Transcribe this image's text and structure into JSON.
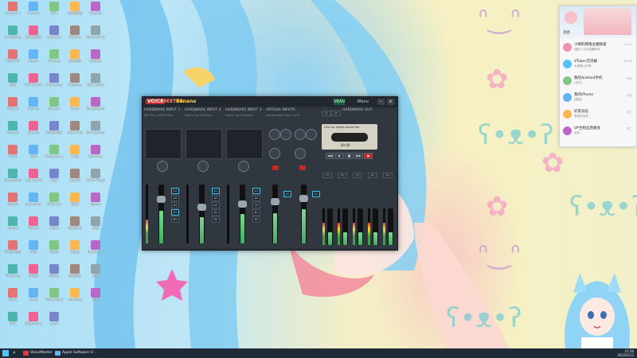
{
  "desktop": {
    "icons": [
      "Scratch 3",
      "Foxmail",
      "RDR",
      "小鸡模拟器",
      "Thunder",
      "MarkDown",
      "雷电模拟器",
      "Audacity",
      "VMware",
      "Microsoft Edge",
      "UPUPOO",
      "Steam",
      "Chrome",
      "百度网盘",
      "腾讯QQ",
      "微信",
      "OBS Studio",
      "Photoshop",
      "Premiere",
      "WPS Office",
      "VSCode",
      "GitHub",
      "Blender",
      "Zoom",
      "VoiceMeeter",
      "Discord",
      "Spotify",
      "网易云音乐",
      "Unity Hub",
      "Epic Games",
      "FFXIV",
      "原神",
      "Notepad++",
      "7-Zip",
      "Bandizip",
      "Everything",
      "Clip Studio",
      "SAI2",
      "Live2D",
      "VTube Studio",
      "Python",
      "Anaconda",
      "PyCharm",
      "IDEA",
      "Typora",
      "Xmind",
      "Todesk",
      "向日葵",
      "KK录像机",
      "剪映",
      "Bilibili直播",
      "抖音",
      "Origin",
      "Uplay",
      "Battle.net",
      "WeGame",
      "此电脑",
      "回收站",
      "控制面板",
      "网络",
      "Word",
      "Excel",
      "PowerPoint",
      "OneNote",
      "迅雷",
      "IDM",
      "qBittorrent",
      "aria2"
    ]
  },
  "voicemeeter": {
    "logo_voice": "VOICE",
    "logo_meeter": "MEETER",
    "logo_banana": "Banana",
    "menu_label": "Menu",
    "vban_label": "VBAN",
    "strips": [
      {
        "name": "HARDWARE INPUT 1",
        "sub": "MIC Ch1 (USB Audio)"
      },
      {
        "name": "HARDWARE INPUT 2",
        "sub": "Select Input Device"
      },
      {
        "name": "HARDWARE INPUT 3",
        "sub": "Select Input Device"
      },
      {
        "name": "VIRTUAL INPUTS",
        "sub": "Voicemeeter VAIO / AUX"
      }
    ],
    "hardware_out_label": "HARDWARE OUT",
    "cassette_label": "Click to Select Audio File",
    "cassette_time": "00:00",
    "bus_buttons": [
      "A1",
      "A2",
      "A3",
      "B1",
      "B2"
    ],
    "out_labels": [
      "A1",
      "A2",
      "A3",
      "B1",
      "B2"
    ],
    "fader_levels": [
      0.55,
      0.45,
      0.5,
      0.52,
      0.58,
      0.35,
      0.35,
      0.35,
      0.35,
      0.35
    ]
  },
  "qq": {
    "tab_label": "消息",
    "items": [
      {
        "name": "小明的网络主播频道",
        "msg": "[图片] 今天直播时间",
        "time": "10:23"
      },
      {
        "name": "VTuber交流群",
        "msg": "大家晚上好呀",
        "time": "09:58"
      },
      {
        "name": "我的Android手机",
        "msg": "[文件]",
        "time": "昨天"
      },
      {
        "name": "我的iPhone",
        "msg": "[链接]",
        "time": "昨天"
      },
      {
        "name": "好友动态",
        "msg": "有新的动态",
        "time": "周三"
      },
      {
        "name": "UP主粉丝后援会",
        "msg": "收到",
        "time": "周二"
      }
    ]
  },
  "taskbar": {
    "items": [
      {
        "label": "VoiceMeeter",
        "color": "#e53935"
      },
      {
        "label": "Apple Software U...",
        "color": "#64b5f6"
      }
    ],
    "clock_time": "21:36",
    "clock_date": "2023/5/12"
  },
  "colors": {
    "accent_blue": "#39c2f0",
    "fader_green": "#43a047",
    "taskbar": "#1f2a36"
  }
}
